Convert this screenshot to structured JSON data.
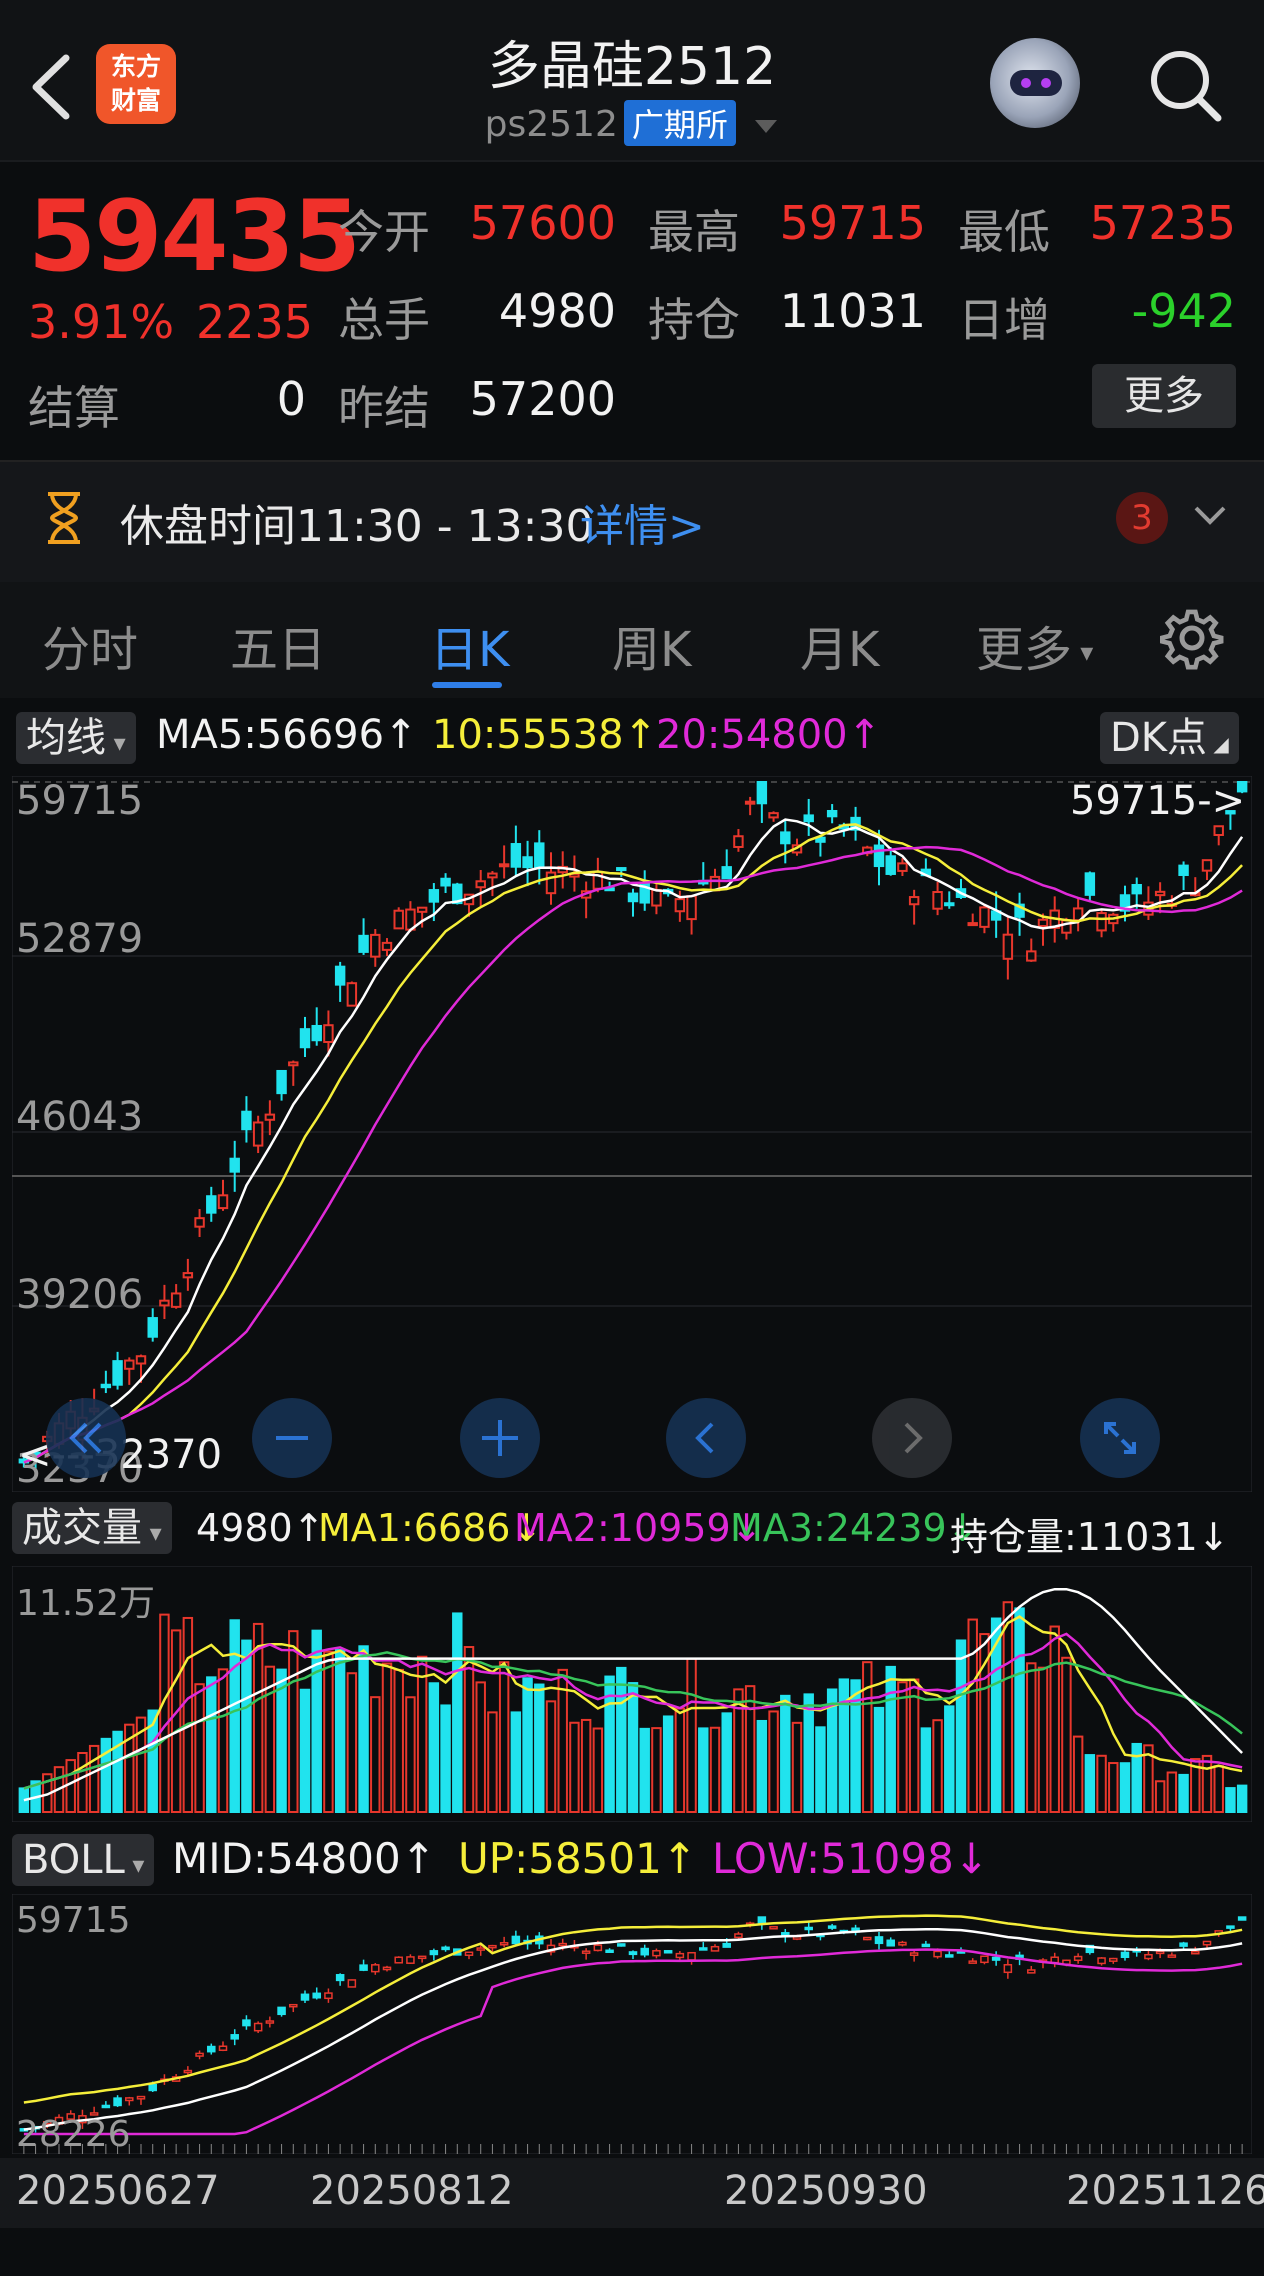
{
  "header": {
    "logo_line1": "东方",
    "logo_line2": "财富",
    "title": "多晶硅2512",
    "code": "ps2512",
    "exchange": "广期所"
  },
  "quote": {
    "price": "59435",
    "change_pct": "3.91%",
    "change": "2235",
    "fields": {
      "open_label": "今开",
      "open": "57600",
      "high_label": "最高",
      "high": "59715",
      "low_label": "最低",
      "low": "57235",
      "vol_label": "总手",
      "vol": "4980",
      "oi_label": "持仓",
      "oi": "11031",
      "oi_chg_label": "日增",
      "oi_chg": "-942",
      "settle_label": "结算",
      "settle": "0",
      "prev_settle_label": "昨结",
      "prev_settle": "57200"
    },
    "more_label": "更多"
  },
  "notice": {
    "text": "休盘时间11:30 - 13:30",
    "link": "详情>",
    "count": "3"
  },
  "tabs": [
    "分时",
    "五日",
    "日K",
    "周K",
    "月K",
    "更多"
  ],
  "active_tab": 2,
  "ma_bar": {
    "selector": "均线",
    "ma5": "MA5:56696↑",
    "ma10": "10:55538↑",
    "ma20": "20:54800↑",
    "dk": "DK点"
  },
  "kline": {
    "y_labels": [
      "59715",
      "52879",
      "46043",
      "39206",
      "32370"
    ],
    "max_marker": "59715->",
    "min_marker": "<---32370",
    "colors": {
      "up": "#e8372c",
      "down": "#21e3ee",
      "ma5": "#ffffff",
      "ma10": "#f5ee3a",
      "ma20": "#e02ad8"
    }
  },
  "volume": {
    "selector": "成交量",
    "vol": "4980↑",
    "ma1": "MA1:6686↓",
    "ma2": "MA2:10959↓",
    "ma3": "MA3:24239↓",
    "oi": "持仓量:11031↓",
    "top_label": "11.52万"
  },
  "boll": {
    "selector": "BOLL",
    "mid": "MID:54800↑",
    "up": "UP:58501↑",
    "low": "LOW:51098↓",
    "top_label": "59715",
    "bottom_label": "28226"
  },
  "dates": [
    "20250627",
    "20250812",
    "20250930",
    "20251126"
  ]
}
